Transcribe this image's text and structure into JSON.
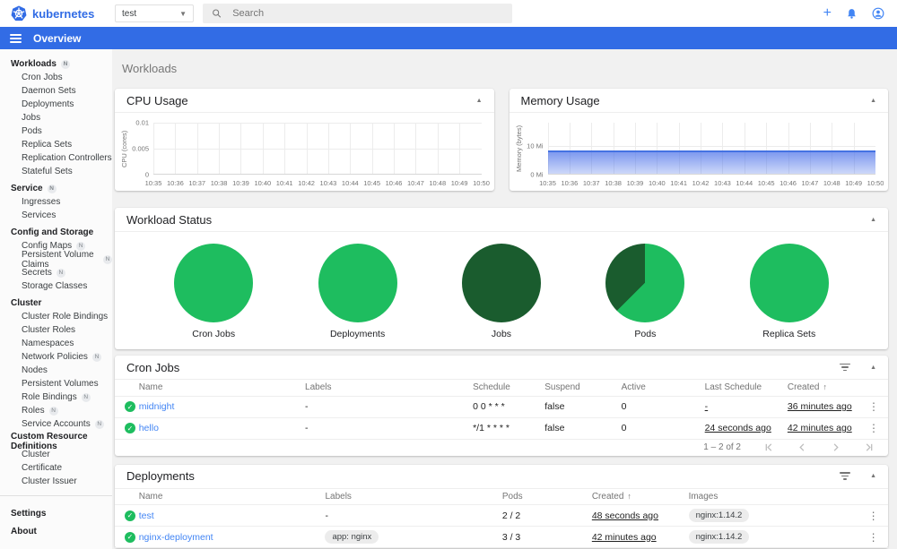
{
  "colors": {
    "brand_blue": "#326ce5",
    "link_blue": "#4285f4",
    "running_green": "#1ebd5f",
    "succeeded_dark_green": "#1a5c2e",
    "memory_area_blue": "#4472e2"
  },
  "topbar": {
    "logo_text": "kubernetes",
    "namespace_value": "test",
    "search_placeholder": "Search",
    "icons": [
      "plus-icon",
      "bell-icon",
      "account-icon"
    ]
  },
  "bluebar": {
    "title": "Overview"
  },
  "sidebar": {
    "groups": [
      {
        "header": "Workloads",
        "badge": "N",
        "items": [
          {
            "label": "Cron Jobs"
          },
          {
            "label": "Daemon Sets"
          },
          {
            "label": "Deployments"
          },
          {
            "label": "Jobs"
          },
          {
            "label": "Pods"
          },
          {
            "label": "Replica Sets"
          },
          {
            "label": "Replication Controllers"
          },
          {
            "label": "Stateful Sets"
          }
        ]
      },
      {
        "header": "Service",
        "badge": "N",
        "items": [
          {
            "label": "Ingresses"
          },
          {
            "label": "Services"
          }
        ]
      },
      {
        "header": "Config and Storage",
        "items": [
          {
            "label": "Config Maps",
            "badge": "N"
          },
          {
            "label": "Persistent Volume Claims",
            "badge": "N"
          },
          {
            "label": "Secrets",
            "badge": "N"
          },
          {
            "label": "Storage Classes"
          }
        ]
      },
      {
        "header": "Cluster",
        "items": [
          {
            "label": "Cluster Role Bindings"
          },
          {
            "label": "Cluster Roles"
          },
          {
            "label": "Namespaces"
          },
          {
            "label": "Network Policies",
            "badge": "N"
          },
          {
            "label": "Nodes"
          },
          {
            "label": "Persistent Volumes"
          },
          {
            "label": "Role Bindings",
            "badge": "N"
          },
          {
            "label": "Roles",
            "badge": "N"
          },
          {
            "label": "Service Accounts",
            "badge": "N"
          }
        ]
      },
      {
        "header": "Custom Resource Definitions",
        "items": [
          {
            "label": "Cluster"
          },
          {
            "label": "Certificate"
          },
          {
            "label": "Cluster Issuer"
          }
        ]
      }
    ],
    "footer_items": [
      {
        "label": "Settings"
      },
      {
        "label": "About"
      }
    ]
  },
  "page": {
    "title": "Workloads"
  },
  "chart_data": [
    {
      "type": "line",
      "title": "CPU Usage",
      "ylabel": "CPU (cores)",
      "ylim": [
        0,
        0.01
      ],
      "yticks": [
        {
          "label": "0.01",
          "pos": 0
        },
        {
          "label": "0.005",
          "pos": 50
        },
        {
          "label": "0",
          "pos": 100
        }
      ],
      "x": [
        "10:35",
        "10:36",
        "10:37",
        "10:38",
        "10:39",
        "10:40",
        "10:41",
        "10:42",
        "10:43",
        "10:44",
        "10:45",
        "10:46",
        "10:47",
        "10:48",
        "10:49",
        "10:50"
      ],
      "series": [
        {
          "name": "CPU",
          "values": [
            0,
            0,
            0,
            0,
            0,
            0,
            0,
            0,
            0,
            0,
            0,
            0,
            0,
            0,
            0,
            0
          ]
        }
      ],
      "grid": true,
      "area_height_pct": 0
    },
    {
      "type": "area",
      "title": "Memory Usage",
      "ylabel": "Memory (bytes)",
      "ylim_mi": [
        0,
        18
      ],
      "yticks": [
        {
          "label": "10 Mi",
          "pos": 45
        },
        {
          "label": "0 Mi",
          "pos": 100
        }
      ],
      "x": [
        "10:35",
        "10:36",
        "10:37",
        "10:38",
        "10:39",
        "10:40",
        "10:41",
        "10:42",
        "10:43",
        "10:44",
        "10:45",
        "10:46",
        "10:47",
        "10:48",
        "10:49",
        "10:50"
      ],
      "series": [
        {
          "name": "Memory (Mi)",
          "values": [
            8.4,
            8.4,
            8.4,
            8.4,
            8.4,
            8.4,
            8.4,
            8.4,
            8.4,
            8.4,
            8.4,
            8.4,
            8.4,
            8.4,
            8.4,
            8.4
          ]
        }
      ],
      "grid": true,
      "area_height_pct": 46
    },
    {
      "type": "pie",
      "title": "Workload Status",
      "pies": [
        {
          "label": "Cron Jobs",
          "slices": [
            {
              "name": "running",
              "percent": 100,
              "color": "#1ebd5f"
            }
          ]
        },
        {
          "label": "Deployments",
          "slices": [
            {
              "name": "running",
              "percent": 100,
              "color": "#1ebd5f"
            }
          ]
        },
        {
          "label": "Jobs",
          "slices": [
            {
              "name": "succeeded",
              "percent": 100,
              "color": "#1a5c2e"
            }
          ]
        },
        {
          "label": "Pods",
          "slices": [
            {
              "name": "running",
              "percent": 62.5,
              "color": "#1ebd5f"
            },
            {
              "name": "succeeded",
              "percent": 37.5,
              "color": "#1a5c2e"
            }
          ]
        },
        {
          "label": "Replica Sets",
          "slices": [
            {
              "name": "running",
              "percent": 100,
              "color": "#1ebd5f"
            }
          ]
        }
      ]
    }
  ],
  "cron_jobs_card": {
    "title": "Cron Jobs",
    "columns": [
      "Name",
      "Labels",
      "Schedule",
      "Suspend",
      "Active",
      "Last Schedule",
      "Created"
    ],
    "sorted_column": "Created",
    "rows": [
      {
        "status": "ok",
        "name": "midnight",
        "labels": "-",
        "schedule": "0 0 * * *",
        "suspend": "false",
        "active": "0",
        "last_schedule": "-",
        "created": "36 minutes ago"
      },
      {
        "status": "ok",
        "name": "hello",
        "labels": "-",
        "schedule": "*/1 * * * *",
        "suspend": "false",
        "active": "0",
        "last_schedule": "24 seconds ago",
        "created": "42 minutes ago"
      }
    ],
    "pagination": {
      "range_text": "1 – 2 of 2",
      "buttons": [
        "first-page",
        "previous-page",
        "next-page",
        "last-page"
      ]
    }
  },
  "deployments_card": {
    "title": "Deployments",
    "columns": [
      "Name",
      "Labels",
      "Pods",
      "Created",
      "Images"
    ],
    "sorted_column": "Created",
    "rows": [
      {
        "status": "ok",
        "name": "test",
        "labels": "-",
        "labels_chip": null,
        "pods": "2 / 2",
        "created": "48 seconds ago",
        "images_chip": "nginx:1.14.2"
      },
      {
        "status": "ok",
        "name": "nginx-deployment",
        "labels": null,
        "labels_chip": "app: nginx",
        "pods": "3 / 3",
        "created": "42 minutes ago",
        "images_chip": "nginx:1.14.2"
      }
    ]
  }
}
